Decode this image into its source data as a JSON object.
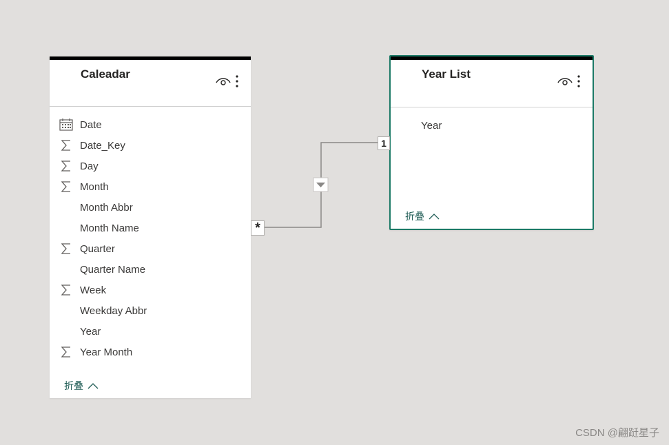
{
  "tables": {
    "calendar": {
      "title": "Caleadar",
      "fields": [
        {
          "label": "Date",
          "icon": "calendar-icon"
        },
        {
          "label": "Date_Key",
          "icon": "sigma-icon"
        },
        {
          "label": "Day",
          "icon": "sigma-icon"
        },
        {
          "label": "Month",
          "icon": "sigma-icon"
        },
        {
          "label": "Month Abbr",
          "icon": ""
        },
        {
          "label": "Month Name",
          "icon": ""
        },
        {
          "label": "Quarter",
          "icon": "sigma-icon"
        },
        {
          "label": "Quarter Name",
          "icon": ""
        },
        {
          "label": "Week",
          "icon": "sigma-icon"
        },
        {
          "label": "Weekday Abbr",
          "icon": ""
        },
        {
          "label": "Year",
          "icon": ""
        },
        {
          "label": "Year Month",
          "icon": "sigma-icon"
        }
      ],
      "collapse_label": "折叠"
    },
    "yearlist": {
      "title": "Year List",
      "fields": [
        {
          "label": "Year",
          "icon": ""
        }
      ],
      "collapse_label": "折叠"
    }
  },
  "relationship": {
    "many_marker": "*",
    "one_marker": "1"
  },
  "watermark": "CSDN @翩跹星子",
  "colors": {
    "canvas": "#e1dfdd",
    "selected_border": "#1b7a66",
    "collapse_text": "#1f5c55"
  }
}
